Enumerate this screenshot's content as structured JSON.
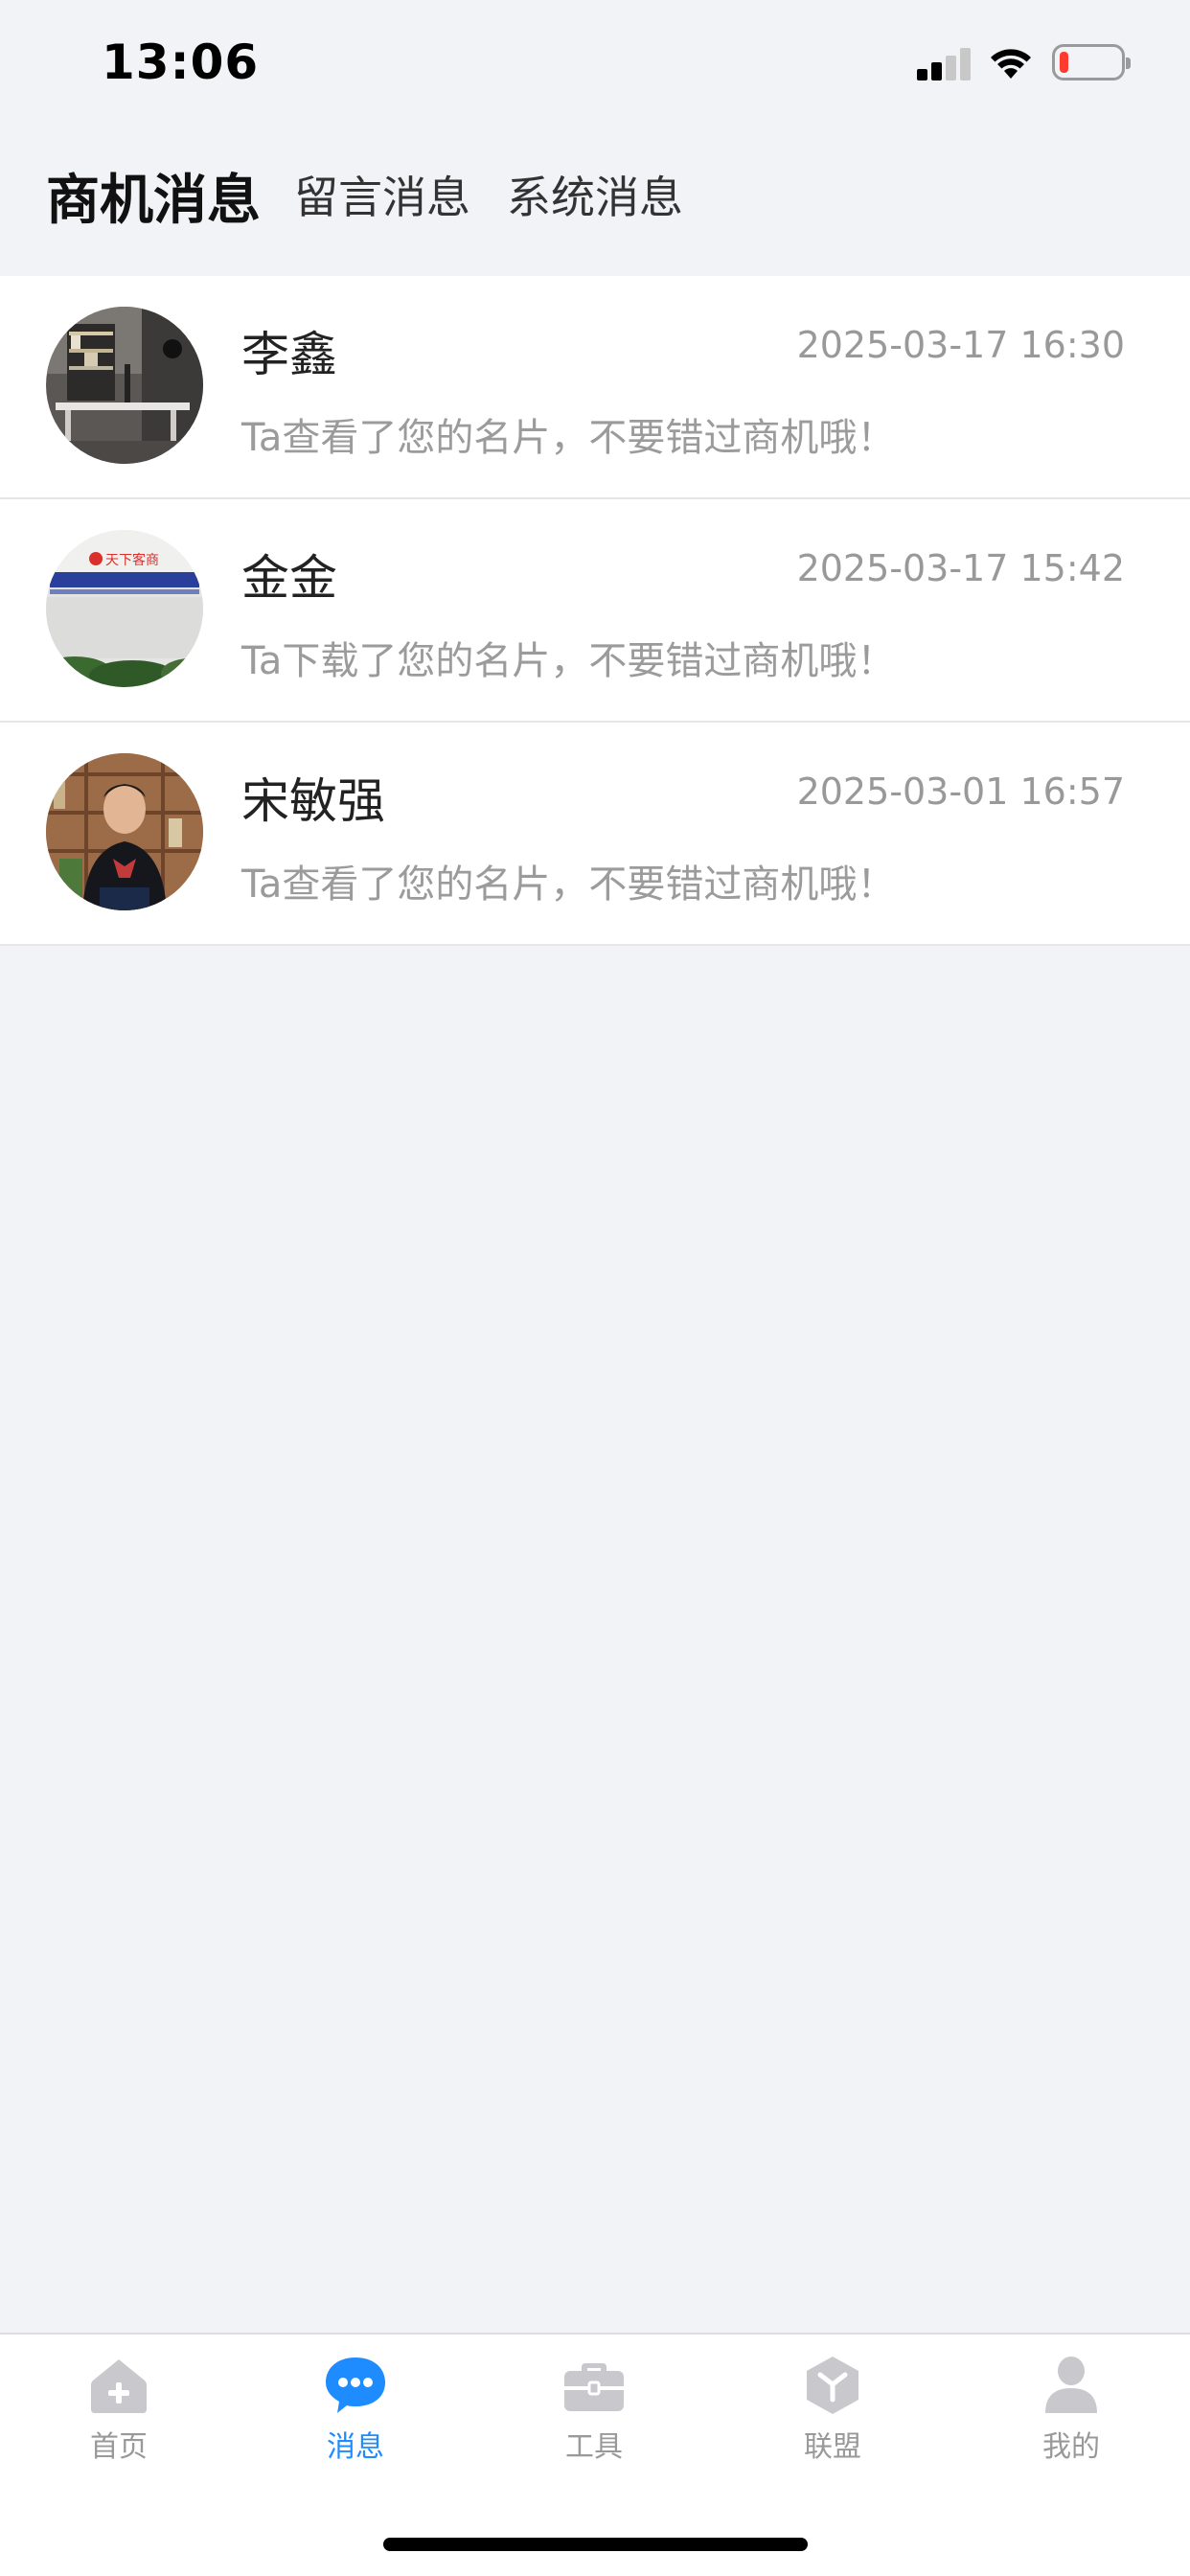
{
  "status_bar": {
    "time": "13:06",
    "battery_color": "#ff3b30"
  },
  "tabs": [
    {
      "label": "商机消息",
      "active": true
    },
    {
      "label": "留言消息",
      "active": false
    },
    {
      "label": "系统消息",
      "active": false
    }
  ],
  "messages": [
    {
      "name": "李鑫",
      "time": "2025-03-17 16:30",
      "preview": "Ta查看了您的名片，不要错过商机哦！",
      "avatar": "photo-office"
    },
    {
      "name": "金金",
      "time": "2025-03-17 15:42",
      "preview": "Ta下载了您的名片，不要错过商机哦！",
      "avatar": "photo-company-sign",
      "avatar_sign_text": "天下客商"
    },
    {
      "name": "宋敏强",
      "time": "2025-03-01 16:57",
      "preview": "Ta查看了您的名片，不要错过商机哦！",
      "avatar": "photo-person"
    }
  ],
  "tabbar": {
    "active_color": "#1e8cff",
    "inactive_color": "#c9c9cd",
    "items": [
      {
        "label": "首页",
        "icon": "home-icon",
        "active": false
      },
      {
        "label": "消息",
        "icon": "message-icon",
        "active": true
      },
      {
        "label": "工具",
        "icon": "toolbox-icon",
        "active": false
      },
      {
        "label": "联盟",
        "icon": "alliance-icon",
        "active": false
      },
      {
        "label": "我的",
        "icon": "user-icon",
        "active": false
      }
    ]
  }
}
